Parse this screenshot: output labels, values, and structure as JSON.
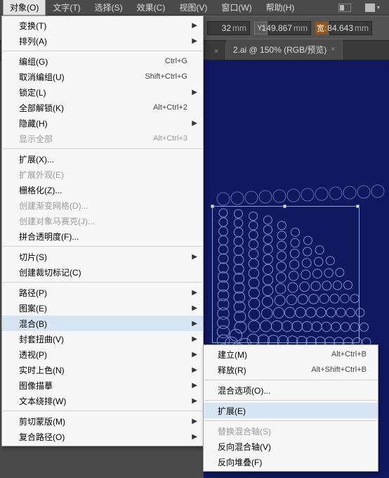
{
  "menubar": {
    "items": [
      "对象(O)",
      "文字(T)",
      "选择(S)",
      "效果(C)",
      "视图(V)",
      "窗口(W)",
      "帮助(H)"
    ]
  },
  "toolbar": {
    "y_label": "Y:",
    "y_value": "149.867",
    "w_label": "宽:",
    "w_value": "84.643",
    "x_value": "32",
    "unit": "mm"
  },
  "tabs": {
    "active_close": "×",
    "t1_label": "2.ai @ 150% (RGB/预览)"
  },
  "menu": {
    "items": [
      {
        "lab": "变换(T)",
        "arrow": true
      },
      {
        "lab": "排列(A)",
        "arrow": true
      },
      {
        "sep": true
      },
      {
        "lab": "编组(G)",
        "scut": "Ctrl+G"
      },
      {
        "lab": "取消编组(U)",
        "scut": "Shift+Ctrl+G"
      },
      {
        "lab": "锁定(L)",
        "arrow": true
      },
      {
        "lab": "全部解锁(K)",
        "scut": "Alt+Ctrl+2"
      },
      {
        "lab": "隐藏(H)",
        "arrow": true
      },
      {
        "lab": "显示全部",
        "scut": "Alt+Ctrl+3",
        "disabled": true
      },
      {
        "sep": true
      },
      {
        "lab": "扩展(X)..."
      },
      {
        "lab": "扩展外观(E)",
        "disabled": true
      },
      {
        "lab": "栅格化(Z)..."
      },
      {
        "lab": "创建渐变网格(D)...",
        "disabled": true
      },
      {
        "lab": "创建对象马赛克(J)...",
        "disabled": true
      },
      {
        "lab": "拼合透明度(F)..."
      },
      {
        "sep": true
      },
      {
        "lab": "切片(S)",
        "arrow": true
      },
      {
        "lab": "创建裁切标记(C)"
      },
      {
        "sep": true
      },
      {
        "lab": "路径(P)",
        "arrow": true
      },
      {
        "lab": "图案(E)",
        "arrow": true
      },
      {
        "lab": "混合(B)",
        "arrow": true,
        "hover": true
      },
      {
        "lab": "封套扭曲(V)",
        "arrow": true
      },
      {
        "lab": "透视(P)",
        "arrow": true
      },
      {
        "lab": "实时上色(N)",
        "arrow": true
      },
      {
        "lab": "图像描摹",
        "arrow": true
      },
      {
        "lab": "文本绕排(W)",
        "arrow": true
      },
      {
        "sep": true
      },
      {
        "lab": "剪切蒙版(M)",
        "arrow": true
      },
      {
        "lab": "复合路径(O)",
        "arrow": true
      }
    ]
  },
  "submenu": {
    "items": [
      {
        "lab": "建立(M)",
        "scut": "Alt+Ctrl+B"
      },
      {
        "lab": "释放(R)",
        "scut": "Alt+Shift+Ctrl+B"
      },
      {
        "sep": true
      },
      {
        "lab": "混合选项(O)..."
      },
      {
        "sep": true
      },
      {
        "lab": "扩展(E)",
        "hover": true
      },
      {
        "sep": true
      },
      {
        "lab": "替换混合轴(S)",
        "disabled": true
      },
      {
        "lab": "反向混合轴(V)"
      },
      {
        "lab": "反向堆叠(F)"
      }
    ]
  }
}
